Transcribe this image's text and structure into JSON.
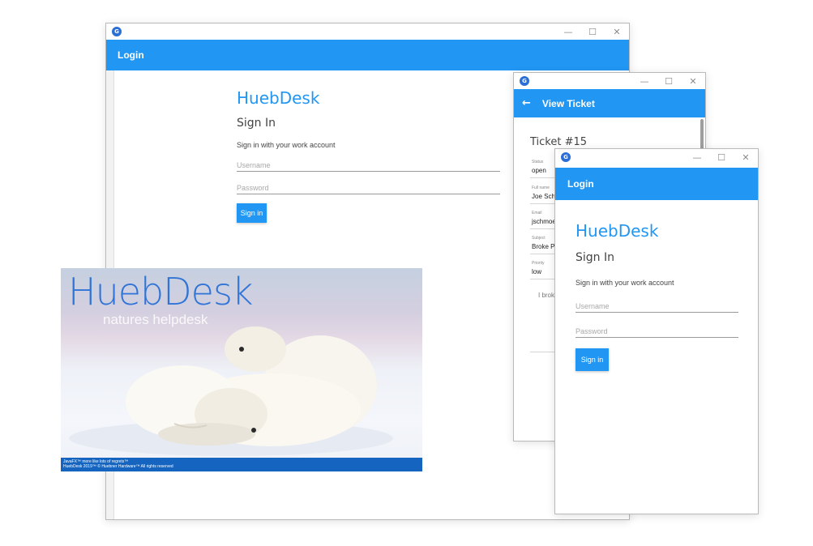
{
  "app_icon_glyph": "G",
  "window_controls": {
    "minimize": "—",
    "maximize": "☐",
    "close": "✕"
  },
  "main_window": {
    "appbar_title": "Login",
    "brand": "HuebDesk",
    "heading": "Sign In",
    "subtitle": "Sign in with your work account",
    "username_placeholder": "Username",
    "password_placeholder": "Password",
    "button_label": "Sign in"
  },
  "ticket_window": {
    "appbar_title": "View Ticket",
    "back_icon": "arrow-left-icon",
    "ticket_title": "Ticket #15",
    "fields": [
      {
        "label": "Status",
        "value": "open"
      },
      {
        "label": "Full name",
        "value": "Joe Schmoe"
      },
      {
        "label": "Email",
        "value": "jschmoe@huebner.com"
      },
      {
        "label": "Subject",
        "value": "Broke PC"
      },
      {
        "label": "Priority",
        "value": "low"
      }
    ],
    "body_text": "I broke my PC"
  },
  "small_window": {
    "appbar_title": "Login",
    "brand": "HuebDesk",
    "heading": "Sign In",
    "subtitle": "Sign in with your work account",
    "username_placeholder": "Username",
    "password_placeholder": "Password",
    "button_label": "Sign in"
  },
  "splash": {
    "title": "HuebDesk",
    "tagline": "natures helpdesk",
    "footer_line1": "JavaFX™ more like lots of regrets™",
    "footer_line2": "HuebDesk 2019™ © Huebner Hardware™ All rights reserved"
  },
  "colors": {
    "accent": "#2196f3",
    "splash_footer": "#1565c0",
    "splash_title": "#2f74d6"
  }
}
